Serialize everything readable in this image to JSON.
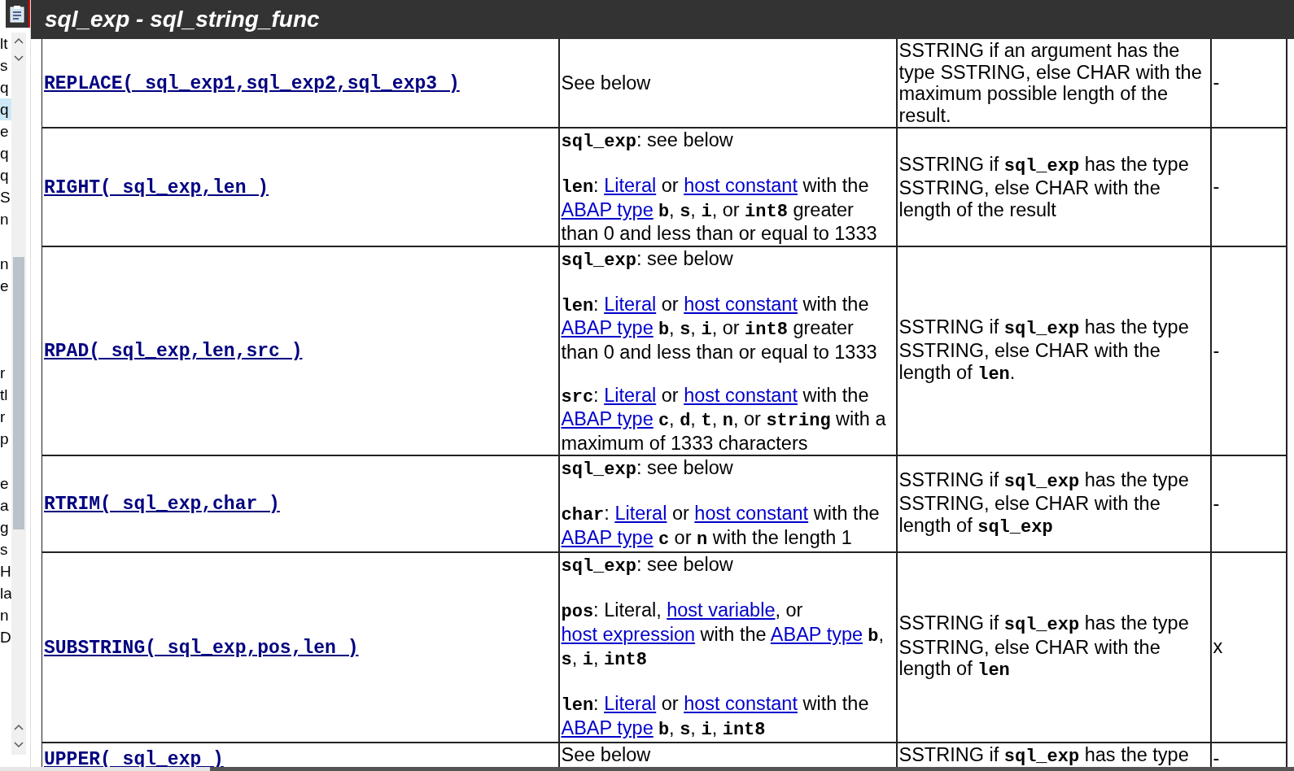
{
  "title": "sql_exp - sql_string_func",
  "sidebar": {
    "groups": [
      {
        "items": [
          {
            "text": "lt",
            "selected": false
          },
          {
            "text": "s",
            "selected": false
          },
          {
            "text": "q",
            "selected": false
          },
          {
            "text": "q",
            "selected": true
          },
          {
            "text": "e",
            "selected": false
          },
          {
            "text": "q",
            "selected": false
          },
          {
            "text": "q",
            "selected": false
          },
          {
            "text": "S",
            "selected": false
          },
          {
            "text": "n",
            "selected": false
          }
        ]
      },
      {
        "items": [
          {
            "text": "n",
            "selected": false
          },
          {
            "text": "e",
            "selected": false
          }
        ]
      },
      {
        "items": [
          {
            "text": "r",
            "selected": false
          },
          {
            "text": "tl",
            "selected": false
          },
          {
            "text": "r",
            "selected": false
          },
          {
            "text": "p",
            "selected": false
          }
        ]
      },
      {
        "items": [
          {
            "text": "e",
            "selected": false
          },
          {
            "text": "a",
            "selected": false
          },
          {
            "text": "g",
            "selected": false
          },
          {
            "text": "s",
            "selected": false
          },
          {
            "text": "H",
            "selected": false
          },
          {
            "text": "la",
            "selected": false
          },
          {
            "text": "n",
            "selected": false
          },
          {
            "text": "D",
            "selected": false
          }
        ]
      }
    ]
  },
  "rows": [
    {
      "function": "REPLACE( sql_exp1,sql_exp2,sql_exp3 )",
      "description": [
        [
          {
            "kind": "text",
            "text": "See below"
          }
        ]
      ],
      "result": [
        [
          {
            "kind": "text",
            "text": "SSTRING if an argument has the type SSTRING, else CHAR with the maximum possible length of the result."
          }
        ]
      ],
      "flag": "-"
    },
    {
      "function": "RIGHT( sql_exp,len )",
      "description": [
        [
          {
            "kind": "code",
            "text": "sql_exp"
          },
          {
            "kind": "text",
            "text": ": see below"
          }
        ],
        [
          {
            "kind": "code",
            "text": "len"
          },
          {
            "kind": "text",
            "text": ": "
          },
          {
            "kind": "link",
            "text": "Literal"
          },
          {
            "kind": "text",
            "text": " or "
          },
          {
            "kind": "link",
            "text": "host constant"
          },
          {
            "kind": "text",
            "text": " with the "
          },
          {
            "kind": "link",
            "text": "ABAP type"
          },
          {
            "kind": "code",
            "text": "b",
            "spaced": true
          },
          {
            "kind": "text",
            "text": ", "
          },
          {
            "kind": "code",
            "text": "s"
          },
          {
            "kind": "text",
            "text": ", "
          },
          {
            "kind": "code",
            "text": "i"
          },
          {
            "kind": "text",
            "text": ", or "
          },
          {
            "kind": "code",
            "text": "int8"
          },
          {
            "kind": "text",
            "text": " greater than 0 and less than or equal to 1333"
          }
        ]
      ],
      "result": [
        [
          {
            "kind": "text",
            "text": "SSTRING if "
          },
          {
            "kind": "code",
            "text": "sql_exp"
          },
          {
            "kind": "text",
            "text": " has the type SSTRING, else CHAR with the length of the result"
          }
        ]
      ],
      "flag": "-"
    },
    {
      "function": "RPAD( sql_exp,len,src )",
      "description": [
        [
          {
            "kind": "code",
            "text": "sql_exp"
          },
          {
            "kind": "text",
            "text": ": see below"
          }
        ],
        [
          {
            "kind": "code",
            "text": "len"
          },
          {
            "kind": "text",
            "text": ": "
          },
          {
            "kind": "link",
            "text": "Literal"
          },
          {
            "kind": "text",
            "text": " or "
          },
          {
            "kind": "link",
            "text": "host constant"
          },
          {
            "kind": "text",
            "text": " with the "
          },
          {
            "kind": "link",
            "text": "ABAP type"
          },
          {
            "kind": "code",
            "text": "b",
            "spaced": true
          },
          {
            "kind": "text",
            "text": ", "
          },
          {
            "kind": "code",
            "text": "s"
          },
          {
            "kind": "text",
            "text": ", "
          },
          {
            "kind": "code",
            "text": "i"
          },
          {
            "kind": "text",
            "text": ", or "
          },
          {
            "kind": "code",
            "text": "int8"
          },
          {
            "kind": "text",
            "text": " greater than 0 and less than or equal to 1333"
          }
        ],
        [
          {
            "kind": "code",
            "text": "src"
          },
          {
            "kind": "text",
            "text": ": "
          },
          {
            "kind": "link",
            "text": "Literal"
          },
          {
            "kind": "text",
            "text": " or "
          },
          {
            "kind": "link",
            "text": "host constant"
          },
          {
            "kind": "text",
            "text": " with the "
          },
          {
            "kind": "link",
            "text": "ABAP type"
          },
          {
            "kind": "code",
            "text": "c",
            "spaced": true
          },
          {
            "kind": "text",
            "text": ", "
          },
          {
            "kind": "code",
            "text": "d"
          },
          {
            "kind": "text",
            "text": ", "
          },
          {
            "kind": "code",
            "text": "t"
          },
          {
            "kind": "text",
            "text": ", "
          },
          {
            "kind": "code",
            "text": "n"
          },
          {
            "kind": "text",
            "text": ", or "
          },
          {
            "kind": "code",
            "text": "string"
          },
          {
            "kind": "text",
            "text": " with a maximum of 1333 characters"
          }
        ]
      ],
      "result": [
        [
          {
            "kind": "text",
            "text": "SSTRING if "
          },
          {
            "kind": "code",
            "text": "sql_exp"
          },
          {
            "kind": "text",
            "text": " has the type SSTRING, else CHAR with the length of "
          },
          {
            "kind": "code",
            "text": "len"
          },
          {
            "kind": "text",
            "text": "."
          }
        ]
      ],
      "flag": "-"
    },
    {
      "function": "RTRIM( sql_exp,char )",
      "description": [
        [
          {
            "kind": "code",
            "text": "sql_exp"
          },
          {
            "kind": "text",
            "text": ": see below"
          }
        ],
        [
          {
            "kind": "code",
            "text": "char"
          },
          {
            "kind": "text",
            "text": ": "
          },
          {
            "kind": "link",
            "text": "Literal"
          },
          {
            "kind": "text",
            "text": " or "
          },
          {
            "kind": "link",
            "text": "host constant"
          },
          {
            "kind": "text",
            "text": " with the "
          },
          {
            "kind": "link",
            "text": "ABAP type"
          },
          {
            "kind": "code",
            "text": "c",
            "spaced": true
          },
          {
            "kind": "text",
            "text": " or "
          },
          {
            "kind": "code",
            "text": "n"
          },
          {
            "kind": "text",
            "text": " with the length 1"
          }
        ]
      ],
      "result": [
        [
          {
            "kind": "text",
            "text": "SSTRING if "
          },
          {
            "kind": "code",
            "text": "sql_exp"
          },
          {
            "kind": "text",
            "text": " has the type SSTRING, else CHAR with the length of "
          },
          {
            "kind": "code",
            "text": "sql_exp"
          }
        ]
      ],
      "flag": "-"
    },
    {
      "function": "SUBSTRING( sql_exp,pos,len )",
      "description": [
        [
          {
            "kind": "code",
            "text": "sql_exp"
          },
          {
            "kind": "text",
            "text": ": see below"
          }
        ],
        [
          {
            "kind": "code",
            "text": "pos"
          },
          {
            "kind": "text",
            "text": ": Literal, "
          },
          {
            "kind": "link",
            "text": "host variable"
          },
          {
            "kind": "text",
            "text": ", or "
          },
          {
            "kind": "link",
            "text": "host expression"
          },
          {
            "kind": "text",
            "text": " with the "
          },
          {
            "kind": "link",
            "text": "ABAP type"
          },
          {
            "kind": "code",
            "text": "b",
            "spaced": true
          },
          {
            "kind": "text",
            "text": ", "
          },
          {
            "kind": "code",
            "text": "s"
          },
          {
            "kind": "text",
            "text": ", "
          },
          {
            "kind": "code",
            "text": "i"
          },
          {
            "kind": "text",
            "text": ", "
          },
          {
            "kind": "code",
            "text": "int8"
          }
        ],
        [
          {
            "kind": "code",
            "text": "len"
          },
          {
            "kind": "text",
            "text": ": "
          },
          {
            "kind": "link",
            "text": "Literal"
          },
          {
            "kind": "text",
            "text": " or "
          },
          {
            "kind": "link",
            "text": "host constant"
          },
          {
            "kind": "text",
            "text": " with the "
          },
          {
            "kind": "link",
            "text": "ABAP type"
          },
          {
            "kind": "code",
            "text": "b",
            "spaced": true
          },
          {
            "kind": "text",
            "text": ", "
          },
          {
            "kind": "code",
            "text": "s"
          },
          {
            "kind": "text",
            "text": ", "
          },
          {
            "kind": "code",
            "text": "i"
          },
          {
            "kind": "text",
            "text": ", "
          },
          {
            "kind": "code",
            "text": "int8"
          }
        ]
      ],
      "result": [
        [
          {
            "kind": "text",
            "text": "SSTRING if "
          },
          {
            "kind": "code",
            "text": "sql_exp"
          },
          {
            "kind": "text",
            "text": " has the type SSTRING, else CHAR with the length of "
          },
          {
            "kind": "code",
            "text": "len"
          }
        ]
      ],
      "flag": "x"
    },
    {
      "function": "UPPER( sql_exp )",
      "description": [
        [
          {
            "kind": "text",
            "text": "See below"
          }
        ]
      ],
      "result": [
        [
          {
            "kind": "text",
            "text": "SSTRING if "
          },
          {
            "kind": "code",
            "text": "sql_exp"
          },
          {
            "kind": "text",
            "text": " has the type"
          }
        ]
      ],
      "flag": "-"
    }
  ]
}
